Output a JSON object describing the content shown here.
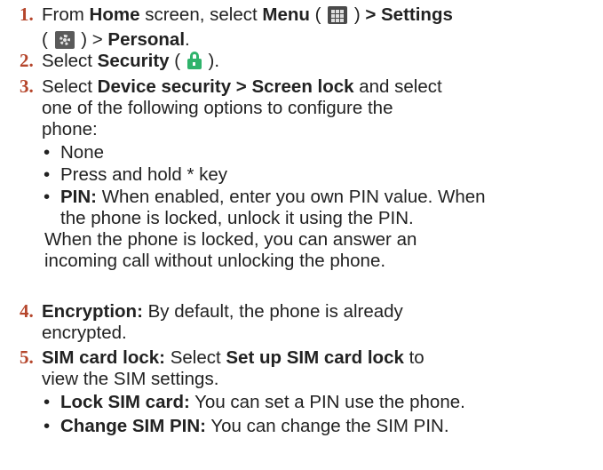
{
  "steps": {
    "s1": {
      "num": "1.",
      "a": "From ",
      "b": "Home",
      "c": " screen, select ",
      "d": "Menu",
      "e": " ( ",
      "f": " ) ",
      "g": "> Settings",
      "h": "( ",
      "i": " ) > ",
      "j": "Personal",
      "k": "."
    },
    "s2": {
      "num": "2.",
      "a": "Select ",
      "b": "Security",
      "c": " ( ",
      "d": " )."
    },
    "s3": {
      "num": "3.",
      "a": "Select ",
      "b": "Device security > Screen lock",
      "c": " and select",
      "line2": "one of the following options to configure the",
      "line3": "phone:",
      "bullets": {
        "none": "None",
        "press": "Press and hold * key",
        "pin_label": "PIN:",
        "pin_text": " When enabled, enter you own PIN value. When",
        "pin_text2": "the phone is locked, unlock it using the PIN."
      },
      "note1": "When the phone is locked, you can answer an",
      "note2": "incoming call without unlocking the phone."
    },
    "s4": {
      "num": "4.",
      "label": "Encryption:",
      "text": " By default, the phone is already",
      "line2": "encrypted."
    },
    "s5": {
      "num": "5.",
      "label": "SIM card lock:",
      "a": " Select ",
      "b": "Set up SIM card lock",
      "c": " to",
      "line2": "view the SIM settings.",
      "bullets": {
        "lock_label": "Lock SIM card:",
        "lock_text": " You can set a PIN use the phone.",
        "change_label": "Change SIM PIN:",
        "change_text": " You can change the SIM PIN."
      }
    }
  },
  "bullet_glyph": "•",
  "icons": {
    "menu": "menu-grid-icon",
    "settings": "gear-icon",
    "security": "lock-icon"
  },
  "colors": {
    "number": "#b5452b",
    "lock": "#2fb36b"
  }
}
